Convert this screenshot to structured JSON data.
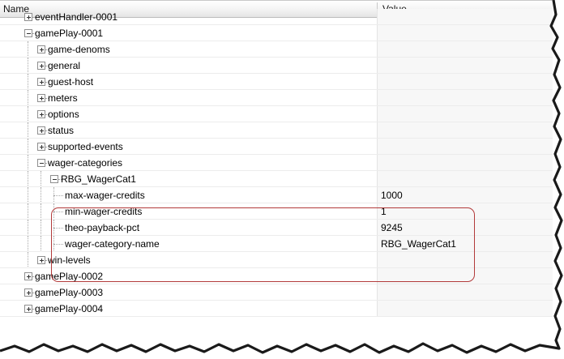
{
  "header": {
    "name_label": "Name",
    "value_label": "Value"
  },
  "tree": [
    {
      "label": "eventHandler-0001",
      "level": 1,
      "toggle": "plus",
      "value": ""
    },
    {
      "label": "gamePlay-0001",
      "level": 1,
      "toggle": "minus",
      "value": ""
    },
    {
      "label": "game-denoms",
      "level": 2,
      "toggle": "plus",
      "value": ""
    },
    {
      "label": "general",
      "level": 2,
      "toggle": "plus",
      "value": ""
    },
    {
      "label": "guest-host",
      "level": 2,
      "toggle": "plus",
      "value": ""
    },
    {
      "label": "meters",
      "level": 2,
      "toggle": "plus",
      "value": ""
    },
    {
      "label": "options",
      "level": 2,
      "toggle": "plus",
      "value": ""
    },
    {
      "label": "status",
      "level": 2,
      "toggle": "plus",
      "value": ""
    },
    {
      "label": "supported-events",
      "level": 2,
      "toggle": "plus",
      "value": ""
    },
    {
      "label": "wager-categories",
      "level": 2,
      "toggle": "minus",
      "value": ""
    },
    {
      "label": "RBG_WagerCat1",
      "level": 3,
      "toggle": "minus",
      "value": ""
    },
    {
      "label": "max-wager-credits",
      "level": 4,
      "toggle": "none",
      "value": "1000"
    },
    {
      "label": "min-wager-credits",
      "level": 4,
      "toggle": "none",
      "value": "1"
    },
    {
      "label": "theo-payback-pct",
      "level": 4,
      "toggle": "none",
      "value": "9245"
    },
    {
      "label": "wager-category-name",
      "level": 4,
      "toggle": "none",
      "value": "RBG_WagerCat1"
    },
    {
      "label": "win-levels",
      "level": 2,
      "toggle": "plus",
      "value": ""
    },
    {
      "label": "gamePlay-0002",
      "level": 1,
      "toggle": "plus",
      "value": ""
    },
    {
      "label": "gamePlay-0003",
      "level": 1,
      "toggle": "plus",
      "value": ""
    },
    {
      "label": "gamePlay-0004",
      "level": 1,
      "toggle": "plus",
      "value": ""
    }
  ],
  "colors": {
    "highlight": "#b23a3a",
    "value_column_tint": "#f7f7f7",
    "grid_line": "#ececec"
  }
}
